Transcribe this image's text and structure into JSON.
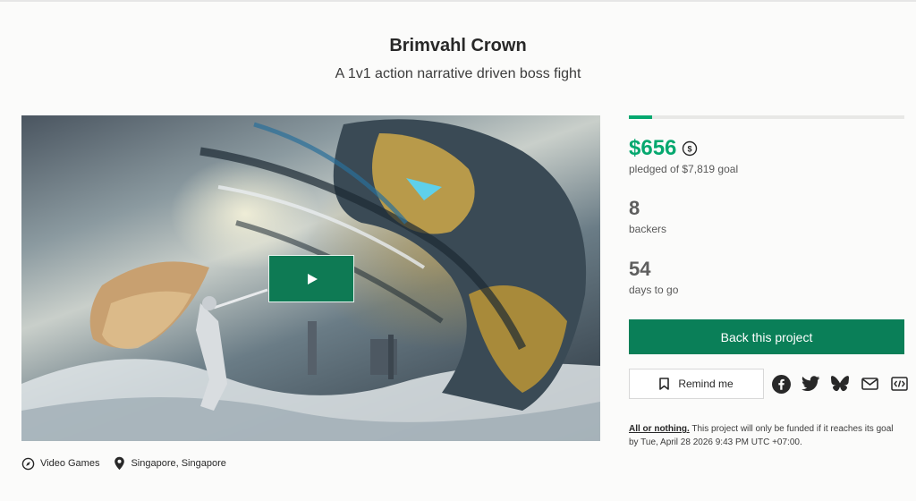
{
  "project": {
    "title": "Brimvahl Crown",
    "subtitle": "A 1v1 action narrative driven boss fight"
  },
  "media": {
    "play_icon": "play-icon"
  },
  "meta": {
    "category": "Video Games",
    "category_icon": "compass-icon",
    "location": "Singapore, Singapore",
    "location_icon": "map-pin-icon"
  },
  "funding": {
    "progress_fraction": 0.084,
    "amount": "$656",
    "pledged_text": "pledged of $7,819 goal",
    "accent_color": "#05a86f"
  },
  "stats": {
    "backers_value": "8",
    "backers_label": "backers",
    "days_value": "54",
    "days_label": "days to go"
  },
  "actions": {
    "back_label": "Back this project",
    "back_color": "#0a7f58",
    "remind_label": "Remind me",
    "share_icons": [
      "facebook-icon",
      "twitter-icon",
      "bluesky-icon",
      "email-icon",
      "embed-icon"
    ]
  },
  "fine_print": {
    "link_text": "All or nothing.",
    "text": " This project will only be funded if it reaches its goal by Tue, April 28 2026 9:43 PM UTC +07:00."
  }
}
